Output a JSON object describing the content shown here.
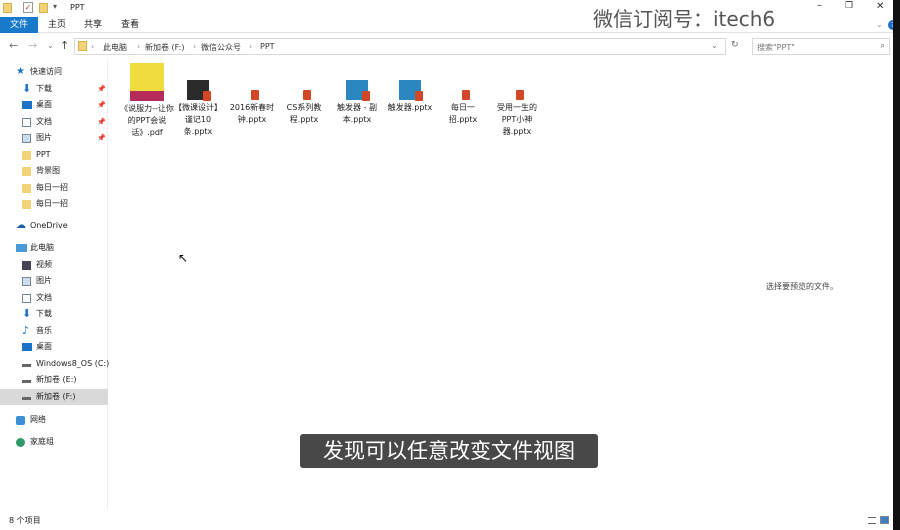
{
  "window": {
    "title": "PPT",
    "minimize": "–",
    "maximize": "❐",
    "close": "✕",
    "help": "?"
  },
  "ribbon": {
    "tabs": [
      "文件",
      "主页",
      "共享",
      "查看"
    ]
  },
  "address": {
    "crumbs": [
      "此电脑",
      "新加卷 (F:)",
      "微信公众号",
      "PPT"
    ],
    "search_placeholder": "搜索\"PPT\""
  },
  "sidebar": {
    "quick_access": "快速访问",
    "quick_items": [
      "下载",
      "桌面",
      "文档",
      "图片",
      "PPT",
      "背景图",
      "每日一招",
      "每日一招"
    ],
    "onedrive": "OneDrive",
    "this_pc": "此电脑",
    "pc_items": [
      "视频",
      "图片",
      "文档",
      "下载",
      "音乐",
      "桌面",
      "Windows8_OS (C:)",
      "新加卷 (E:)",
      "新加卷 (F:)"
    ],
    "network": "网络",
    "homegroup": "家庭组"
  },
  "files": [
    {
      "name": "《说服力--让你的PPT会说话》.pdf",
      "type": "pdf"
    },
    {
      "name": "【微课设计】谨记10条.pptx",
      "type": "pptx-dark"
    },
    {
      "name": "2016新春时钟.pptx",
      "type": "pptx"
    },
    {
      "name": "CS系列教程.pptx",
      "type": "pptx"
    },
    {
      "name": "触发器 - 副本.pptx",
      "type": "pptx-blue"
    },
    {
      "name": "触发器.pptx",
      "type": "pptx-blue"
    },
    {
      "name": "每日一招.pptx",
      "type": "pptx"
    },
    {
      "name": "受用一生的PPT小神器.pptx",
      "type": "pptx"
    }
  ],
  "preview_text": "选择要预览的文件。",
  "status": {
    "count": "8 个项目"
  },
  "watermark": "微信订阅号：itech6",
  "subtitle": "发现可以任意改变文件视图"
}
